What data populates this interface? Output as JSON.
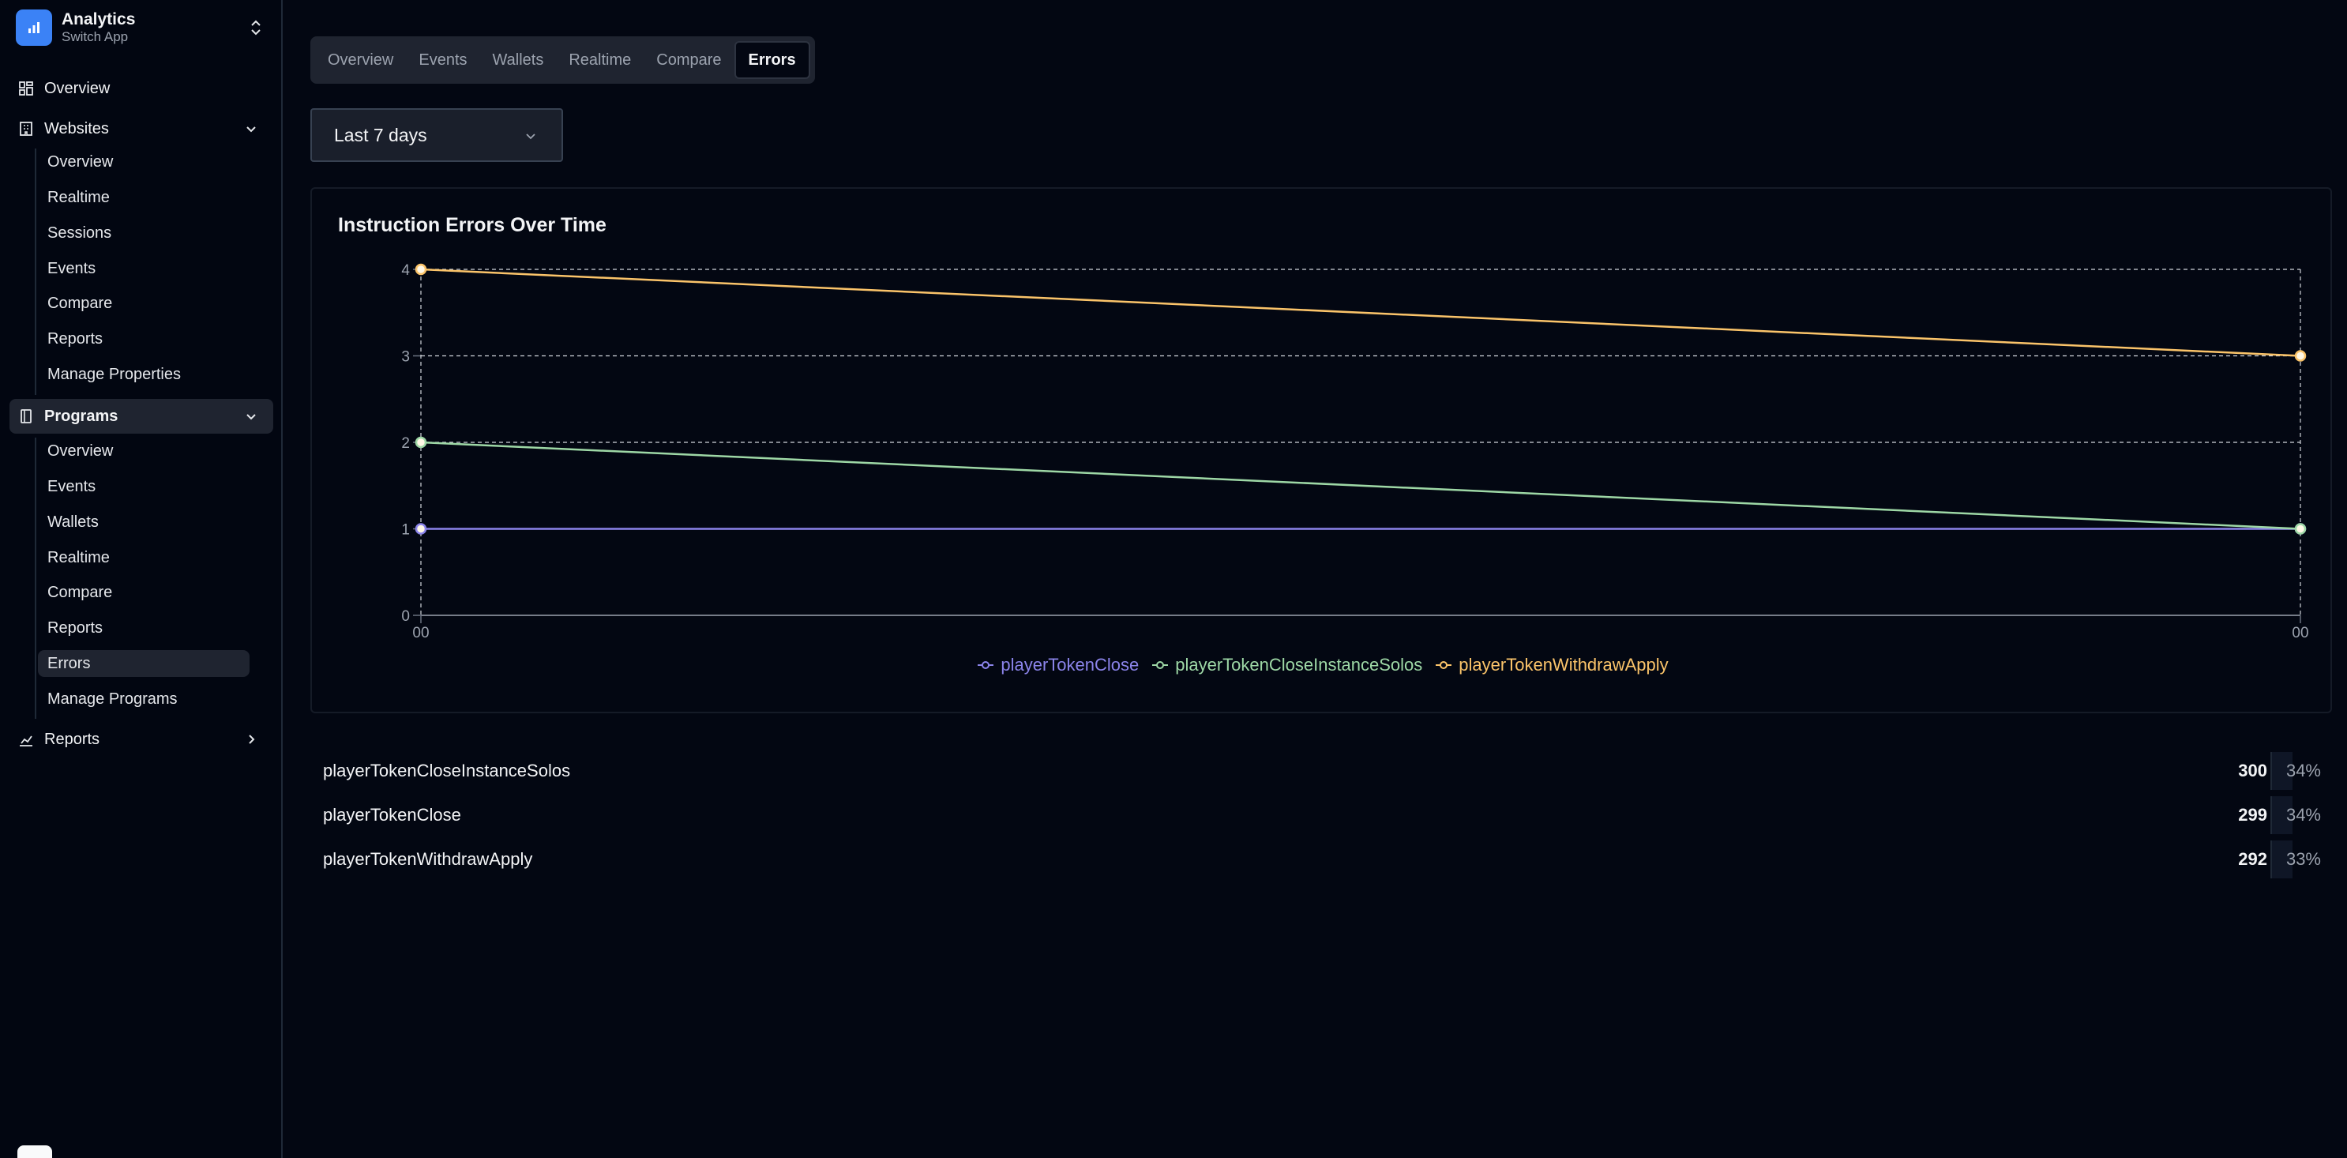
{
  "app": {
    "title": "Analytics",
    "subtitle": "Switch App"
  },
  "sidebar": {
    "overview_label": "Overview",
    "websites": {
      "label": "Websites",
      "items": [
        "Overview",
        "Realtime",
        "Sessions",
        "Events",
        "Compare",
        "Reports",
        "Manage Properties"
      ]
    },
    "programs": {
      "label": "Programs",
      "items": [
        "Overview",
        "Events",
        "Wallets",
        "Realtime",
        "Compare",
        "Reports",
        "Errors",
        "Manage Programs"
      ],
      "active_item": "Errors"
    },
    "reports_label": "Reports"
  },
  "tabs": [
    {
      "label": "Overview"
    },
    {
      "label": "Events"
    },
    {
      "label": "Wallets"
    },
    {
      "label": "Realtime"
    },
    {
      "label": "Compare"
    },
    {
      "label": "Errors",
      "active": true
    }
  ],
  "range_select": {
    "value": "Last 7 days"
  },
  "colors": {
    "playerTokenClose": "#8b84ea",
    "playerTokenCloseInstanceSolos": "#9ed8a6",
    "playerTokenWithdrawApply": "#fbc46a"
  },
  "chart_data": {
    "type": "line",
    "title": "Instruction Errors Over Time",
    "x": [
      "00",
      "00"
    ],
    "ylim": [
      0,
      4
    ],
    "yticks": [
      "0",
      "1",
      "2",
      "3",
      "4"
    ],
    "grid": true,
    "legend_position": "bottom",
    "series": [
      {
        "name": "playerTokenClose",
        "values": [
          1,
          1
        ]
      },
      {
        "name": "playerTokenCloseInstanceSolos",
        "values": [
          2,
          1
        ]
      },
      {
        "name": "playerTokenWithdrawApply",
        "values": [
          4,
          3
        ]
      }
    ]
  },
  "table": {
    "rows": [
      {
        "name": "playerTokenCloseInstanceSolos",
        "count": "300",
        "percent": "34%"
      },
      {
        "name": "playerTokenClose",
        "count": "299",
        "percent": "34%"
      },
      {
        "name": "playerTokenWithdrawApply",
        "count": "292",
        "percent": "33%"
      }
    ]
  }
}
